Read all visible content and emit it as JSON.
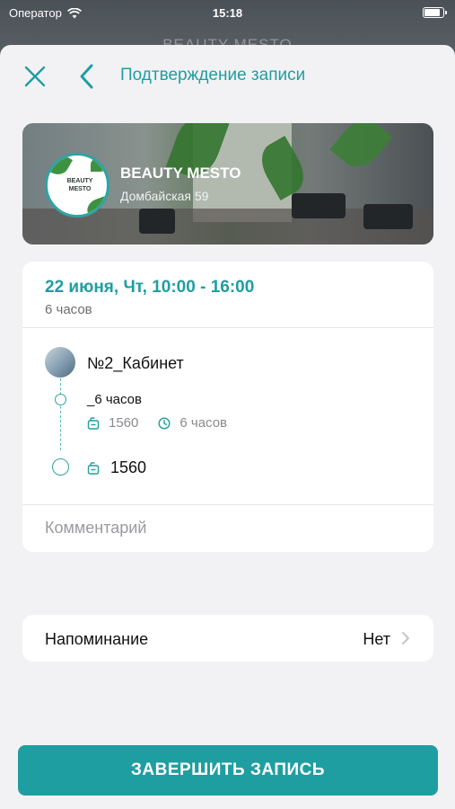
{
  "status_bar": {
    "carrier": "Оператор",
    "time": "15:18",
    "icons": [
      "wifi-icon",
      "battery-icon"
    ]
  },
  "background_title": "BEAUTY MESTO",
  "nav": {
    "title": "Подтверждение записи",
    "icons": [
      "close-icon",
      "back-chevron-icon"
    ]
  },
  "venue": {
    "name": "BEAUTY MESTO",
    "address": "Домбайская 59",
    "logo_text": "BEAUTY MESTO"
  },
  "booking": {
    "date_time": "22 июня, Чт, 10:00 - 16:00",
    "duration": "6 часов",
    "room": "№2_Кабинет",
    "service": {
      "name": "_6 часов",
      "price": "1560",
      "duration": "6 часов"
    },
    "total": "1560",
    "comment_placeholder": "Комментарий"
  },
  "reminder": {
    "label": "Напоминание",
    "value": "Нет"
  },
  "finish_button": "ЗАВЕРШИТЬ ЗАПИСЬ",
  "colors": {
    "accent": "#1f9ea2",
    "background": "#f2f2f4",
    "card": "#ffffff",
    "muted_text": "#8a8a8e"
  }
}
